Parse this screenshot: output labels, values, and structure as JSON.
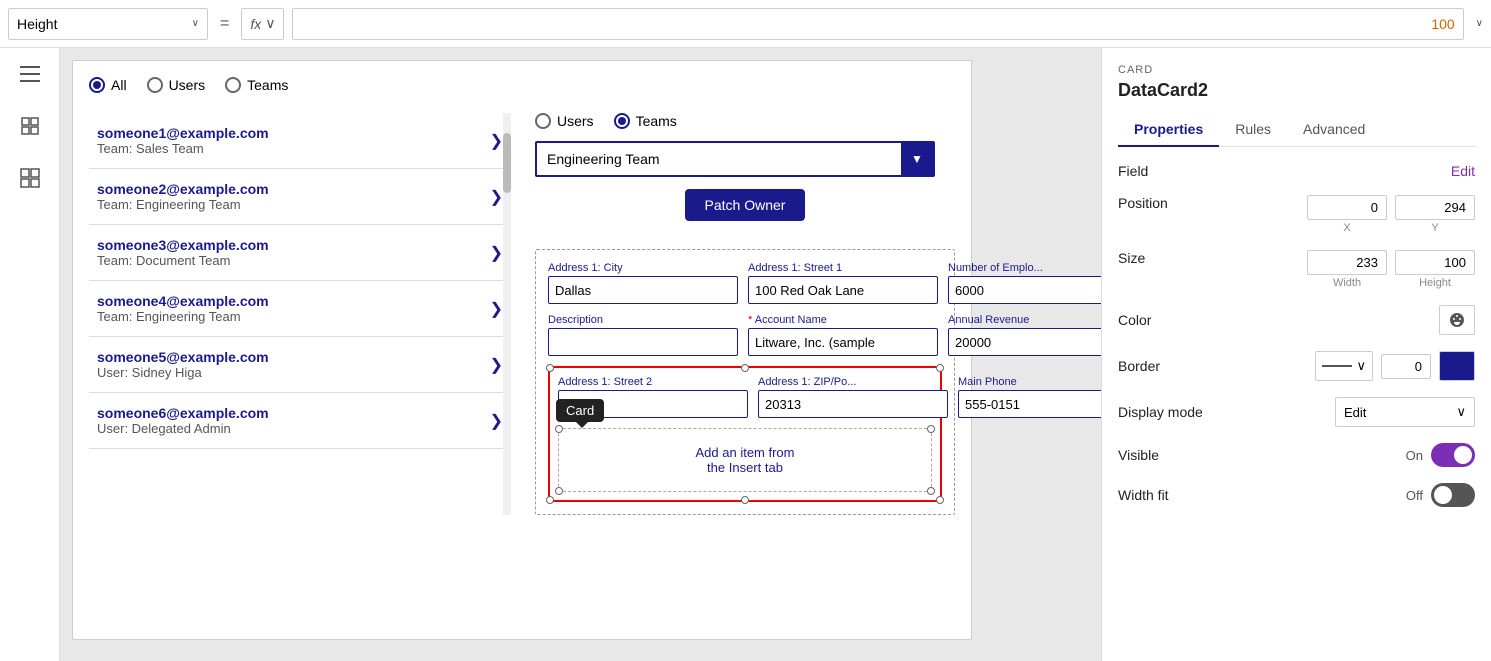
{
  "topbar": {
    "height_label": "Height",
    "equals": "=",
    "fx": "fx",
    "formula_value": "100",
    "chevron": "∨"
  },
  "sidebar": {
    "icons": [
      "≡",
      "⊞",
      "⊟"
    ]
  },
  "canvas": {
    "radio_group": {
      "options": [
        "All",
        "Users",
        "Teams"
      ],
      "selected": "All"
    },
    "users": [
      {
        "email": "someone1@example.com",
        "team": "Team: Sales Team"
      },
      {
        "email": "someone2@example.com",
        "team": "Team: Engineering Team"
      },
      {
        "email": "someone3@example.com",
        "team": "Team: Document Team"
      },
      {
        "email": "someone4@example.com",
        "team": "Team: Engineering Team"
      },
      {
        "email": "someone5@example.com",
        "team": "User: Sidney Higa"
      },
      {
        "email": "someone6@example.com",
        "team": "User: Delegated Admin"
      }
    ],
    "team_form": {
      "radio_options": [
        "Users",
        "Teams"
      ],
      "selected_radio": "Teams",
      "dropdown_value": "Engineering Team",
      "patch_button": "Patch Owner",
      "form_fields": [
        {
          "label": "Address 1: City",
          "value": "Dallas",
          "required": false
        },
        {
          "label": "Address 1: Street 1",
          "value": "100 Red Oak Lane",
          "required": false
        },
        {
          "label": "Number of Emplo...",
          "value": "6000",
          "required": false
        },
        {
          "label": "Description",
          "value": "",
          "required": false
        },
        {
          "label": "Account Name",
          "value": "Litware, Inc. (sample",
          "required": true
        },
        {
          "label": "Annual Revenue",
          "value": "20000",
          "required": false
        },
        {
          "label": "Address 1: Street 2",
          "value": "",
          "required": false
        },
        {
          "label": "Address 1: ZIP/Po...",
          "value": "20313",
          "required": false
        },
        {
          "label": "Main Phone",
          "value": "555-0151",
          "required": false
        }
      ],
      "card_tooltip": "Card",
      "add_item_text": "Add an item from\nthe Insert tab"
    }
  },
  "properties_panel": {
    "card_label": "CARD",
    "title": "DataCard2",
    "tabs": [
      "Properties",
      "Rules",
      "Advanced"
    ],
    "active_tab": "Properties",
    "field_label": "Field",
    "field_edit": "Edit",
    "position_label": "Position",
    "position_x": "0",
    "position_y": "294",
    "x_label": "X",
    "y_label": "Y",
    "size_label": "Size",
    "size_width": "233",
    "size_height": "100",
    "width_label": "Width",
    "height_label": "Height",
    "color_label": "Color",
    "border_label": "Border",
    "border_value": "0",
    "border_color": "#1a1a8c",
    "display_mode_label": "Display mode",
    "display_mode_value": "Edit",
    "visible_label": "Visible",
    "visible_on": "On",
    "visible_state": "on",
    "width_fit_label": "Width fit",
    "width_fit_off": "Off",
    "width_fit_state": "off"
  }
}
